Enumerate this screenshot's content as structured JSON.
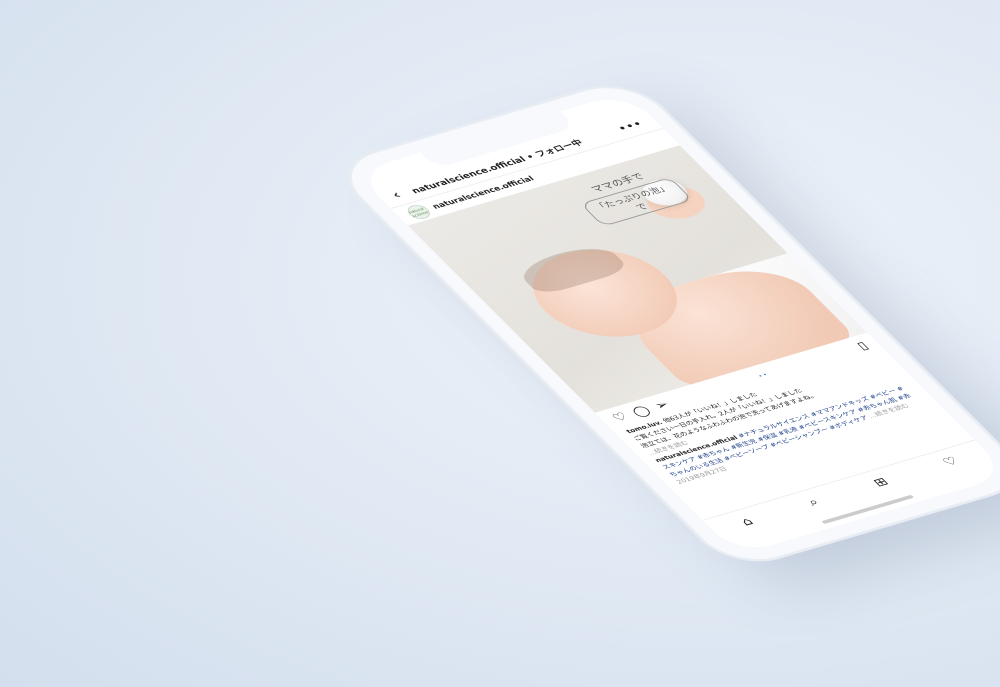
{
  "header": {
    "back_icon": "chevron-left-icon",
    "title": "naturalscience.official • フォロー中",
    "more_icon": "more-dots-icon"
  },
  "post": {
    "avatar_text": "natural science",
    "username": "naturalscience.official",
    "image_caption_line1": "ママの手で",
    "image_caption_line2": "「たっぷりの泡」で",
    "carousel_indicator": "••",
    "likes_line": "ご覧ください一日の手入れ。2人が「いいね！」しました",
    "liked_by_user": "tomo.luv.",
    "liked_by_text": "他63人が「いいね！」しました",
    "comment_preview": "泡立ては、花のようなふわふわの泡で洗ってあげますよね。",
    "more_comments": "...続きを読む",
    "caption_user": "naturalscience.official",
    "caption_text": "#ナチュラルサイエンス #ママアンドキッズ #ベビー #スキンケア #赤ちゃん #新生児 #保湿 #乳液 #ベビースキンケア #赤ちゃん肌 #赤ちゃんのいる生活 #ベビーソープ #ベビーシャンプー #ボディケア",
    "caption_more": "...続きを読む",
    "date": "2019年9月27日"
  },
  "actions": {
    "like_icon": "heart-icon",
    "comment_icon": "comment-icon",
    "share_icon": "send-icon",
    "save_icon": "bookmark-icon"
  },
  "tabbar": {
    "home_icon": "home-icon",
    "search_icon": "search-icon",
    "add_icon": "add-post-icon",
    "activity_icon": "heart-icon"
  }
}
